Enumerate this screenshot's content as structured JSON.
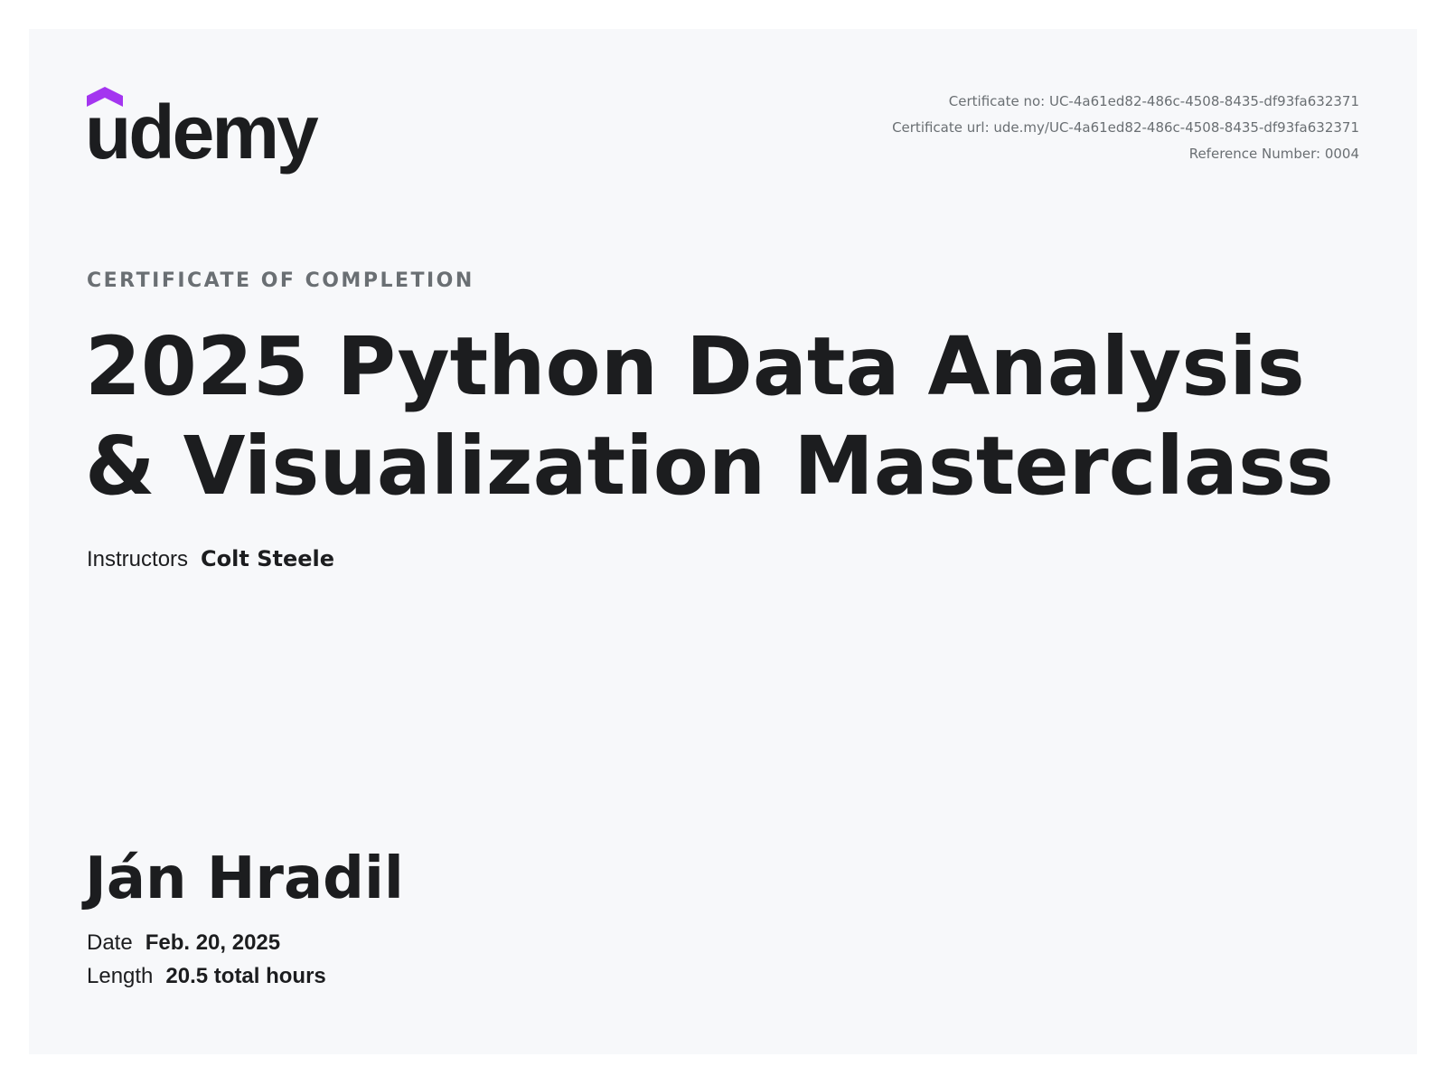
{
  "colors": {
    "brand_purple": "#a435f0",
    "text_dark": "#1c1d1f",
    "text_muted": "#6a6f73",
    "page_background": "#f7f8fa"
  },
  "logo": {
    "icon": "udemy-logo-mark-icon",
    "text": "ûdemy"
  },
  "certificate": {
    "number_label": "Certificate no: UC-4a61ed82-486c-4508-8435-df93fa632371",
    "url_label": "Certificate url: ude.my/UC-4a61ed82-486c-4508-8435-df93fa632371",
    "reference_label": "Reference Number: 0004"
  },
  "heading": "CERTIFICATE OF COMPLETION",
  "course": {
    "title": "2025 Python Data Analysis & Visualization Masterclass",
    "instructors_label": "Instructors",
    "instructors": "Colt Steele"
  },
  "student": {
    "name": "Ján Hradil"
  },
  "details": {
    "date_label": "Date",
    "date": "Feb. 20, 2025",
    "length_label": "Length",
    "length": "20.5 total hours"
  }
}
